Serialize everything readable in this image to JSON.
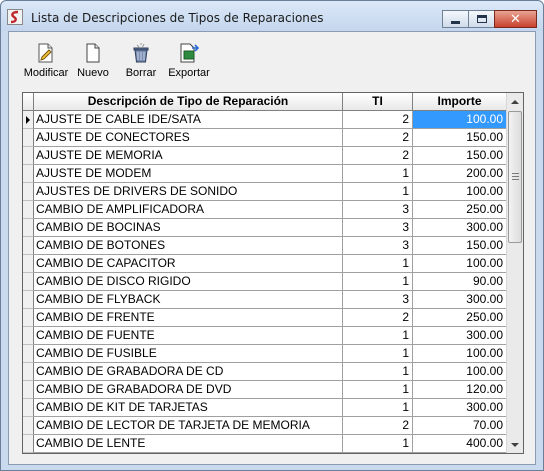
{
  "window": {
    "title": "Lista de Descripciones de Tipos de Reparaciones"
  },
  "toolbar": {
    "buttons": [
      {
        "label": "Modificar",
        "icon": "edit-document-icon"
      },
      {
        "label": "Nuevo",
        "icon": "new-document-icon"
      },
      {
        "label": "Borrar",
        "icon": "trash-icon"
      },
      {
        "label": "Exportar",
        "icon": "export-icon"
      }
    ]
  },
  "grid": {
    "columns": [
      "Descripción de Tipo de Reparación",
      "TI",
      "Importe"
    ],
    "selected_row": 0,
    "rows": [
      {
        "desc": "AJUSTE DE CABLE IDE/SATA",
        "ti": "2",
        "importe": "100.00"
      },
      {
        "desc": "AJUSTE DE CONECTORES",
        "ti": "2",
        "importe": "150.00"
      },
      {
        "desc": "AJUSTE DE MEMORIA",
        "ti": "2",
        "importe": "150.00"
      },
      {
        "desc": "AJUSTE DE MODEM",
        "ti": "1",
        "importe": "200.00"
      },
      {
        "desc": "AJUSTES DE DRIVERS DE SONIDO",
        "ti": "1",
        "importe": "100.00"
      },
      {
        "desc": "CAMBIO DE AMPLIFICADORA",
        "ti": "3",
        "importe": "250.00"
      },
      {
        "desc": "CAMBIO DE BOCINAS",
        "ti": "3",
        "importe": "300.00"
      },
      {
        "desc": "CAMBIO DE BOTONES",
        "ti": "3",
        "importe": "150.00"
      },
      {
        "desc": "CAMBIO DE CAPACITOR",
        "ti": "1",
        "importe": "100.00"
      },
      {
        "desc": "CAMBIO DE DISCO RIGIDO",
        "ti": "1",
        "importe": "90.00"
      },
      {
        "desc": "CAMBIO DE FLYBACK",
        "ti": "3",
        "importe": "300.00"
      },
      {
        "desc": "CAMBIO DE FRENTE",
        "ti": "2",
        "importe": "250.00"
      },
      {
        "desc": "CAMBIO DE FUENTE",
        "ti": "1",
        "importe": "300.00"
      },
      {
        "desc": "CAMBIO DE FUSIBLE",
        "ti": "1",
        "importe": "100.00"
      },
      {
        "desc": "CAMBIO DE GRABADORA DE CD",
        "ti": "1",
        "importe": "100.00"
      },
      {
        "desc": "CAMBIO DE GRABADORA DE DVD",
        "ti": "1",
        "importe": "120.00"
      },
      {
        "desc": "CAMBIO DE KIT DE TARJETAS",
        "ti": "1",
        "importe": "300.00"
      },
      {
        "desc": "CAMBIO DE LECTOR DE TARJETA DE MEMORIA",
        "ti": "2",
        "importe": "70.00"
      },
      {
        "desc": "CAMBIO DE LENTE",
        "ti": "1",
        "importe": "400.00"
      }
    ]
  },
  "colors": {
    "selection": "#3399ff",
    "titlebar": "#c4d6ee",
    "close_button": "#c8412c"
  }
}
